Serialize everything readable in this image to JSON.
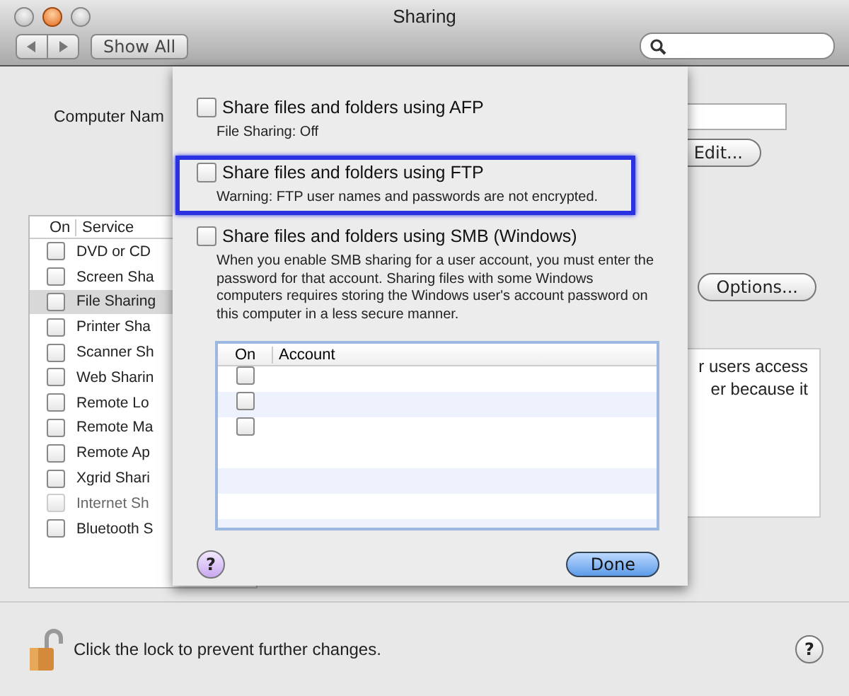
{
  "window": {
    "title": "Sharing"
  },
  "toolbar": {
    "show_all": "Show All"
  },
  "computer_name": {
    "label": "Computer Nam",
    "edit_button": "Edit..."
  },
  "services": {
    "columns": [
      "On",
      "Service"
    ],
    "rows": [
      {
        "name": "DVD or CD",
        "checked": false,
        "selected": false,
        "disabled": false
      },
      {
        "name": "Screen Sha",
        "checked": false,
        "selected": false,
        "disabled": false
      },
      {
        "name": "File Sharing",
        "checked": false,
        "selected": true,
        "disabled": false
      },
      {
        "name": "Printer Sha",
        "checked": false,
        "selected": false,
        "disabled": false
      },
      {
        "name": "Scanner Sh",
        "checked": false,
        "selected": false,
        "disabled": false
      },
      {
        "name": "Web Sharin",
        "checked": false,
        "selected": false,
        "disabled": false
      },
      {
        "name": "Remote Lo",
        "checked": false,
        "selected": false,
        "disabled": false
      },
      {
        "name": "Remote Ma",
        "checked": false,
        "selected": false,
        "disabled": false
      },
      {
        "name": "Remote Ap",
        "checked": false,
        "selected": false,
        "disabled": false
      },
      {
        "name": "Xgrid Shari",
        "checked": false,
        "selected": false,
        "disabled": false
      },
      {
        "name": "Internet Sh",
        "checked": false,
        "selected": false,
        "disabled": true
      },
      {
        "name": "Bluetooth S",
        "checked": false,
        "selected": false,
        "disabled": false
      }
    ]
  },
  "options_button": "Options...",
  "description_lines": [
    "r users access",
    "er because it"
  ],
  "sheet": {
    "options": [
      {
        "label": "Share files and folders using AFP",
        "checked": false,
        "highlighted": false,
        "note": "File Sharing: Off"
      },
      {
        "label": "Share files and folders using FTP",
        "checked": false,
        "highlighted": true,
        "note": "Warning: FTP user names and passwords are not encrypted."
      },
      {
        "label": "Share files and folders using SMB (Windows)",
        "checked": false,
        "highlighted": false,
        "note": "When you enable SMB sharing for a user account, you must enter the password for that account. Sharing files with some Windows computers requires storing the Windows user's account password on this computer in a less secure manner."
      }
    ],
    "accounts": {
      "columns": [
        "On",
        "Account"
      ],
      "rows": [
        {
          "checked": false
        },
        {
          "checked": false
        },
        {
          "checked": false
        }
      ]
    },
    "help": "?",
    "done_button": "Done"
  },
  "lock": {
    "locked": false,
    "text": "Click the lock to prevent further changes."
  },
  "help": "?"
}
